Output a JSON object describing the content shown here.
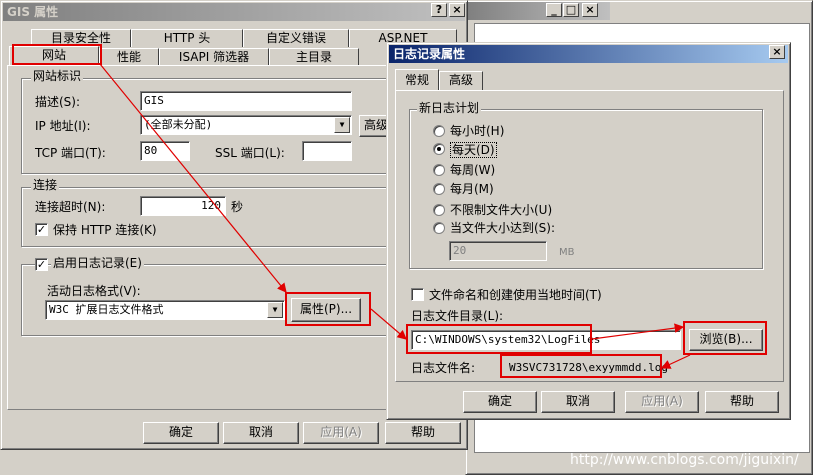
{
  "bg_window": {
    "title": "",
    "buttons": [
      "_",
      "□",
      "×"
    ]
  },
  "main_dialog": {
    "title": "GIS 属性",
    "help_btn": "?",
    "close_btn": "×",
    "tabs_row1": [
      "目录安全性",
      "HTTP 头",
      "自定义错误",
      "ASP.NET"
    ],
    "tabs_row2": [
      "网站",
      "性能",
      "ISAPI 筛选器",
      "主目录"
    ],
    "identity": {
      "group": "网站标识",
      "desc_label": "描述(S):",
      "desc_value": "GIS",
      "ip_label": "IP 地址(I):",
      "ip_value": "(全部未分配)",
      "advanced": "高级",
      "tcp_label": "TCP 端口(T):",
      "tcp_value": "80",
      "ssl_label": "SSL 端口(L):",
      "ssl_value": ""
    },
    "connection": {
      "group": "连接",
      "timeout_label": "连接超时(N):",
      "timeout_value": "120",
      "timeout_unit": "秒",
      "keepalive_label": "保持 HTTP 连接(K)",
      "keepalive_checked": true
    },
    "logging": {
      "enable_label": "启用日志记录(E)",
      "enable_checked": true,
      "format_label": "活动日志格式(V):",
      "format_value": "W3C 扩展日志文件格式",
      "properties": "属性(P)..."
    },
    "buttons": {
      "ok": "确定",
      "cancel": "取消",
      "apply": "应用(A)",
      "help": "帮助"
    }
  },
  "log_dialog": {
    "title": "日志记录属性",
    "close_btn": "×",
    "tabs": [
      "常规",
      "高级"
    ],
    "schedule_group": "新日志计划",
    "radios": [
      {
        "label": "每小时(H)",
        "checked": false
      },
      {
        "label": "每天(D)",
        "checked": true
      },
      {
        "label": "每周(W)",
        "checked": false
      },
      {
        "label": "每月(M)",
        "checked": false
      },
      {
        "label": "不限制文件大小(U)",
        "checked": false
      },
      {
        "label": "当文件大小达到(S):",
        "checked": false
      }
    ],
    "size_value": "20",
    "size_unit": "MB",
    "localtime_label": "文件命名和创建使用当地时间(T)",
    "localtime_checked": false,
    "dir_label": "日志文件目录(L):",
    "dir_value": "C:\\WINDOWS\\system32\\LogFiles",
    "browse": "浏览(B)...",
    "filename_label": "日志文件名:",
    "filename_value": "W3SVC731728\\exyymmdd.log",
    "buttons": {
      "ok": "确定",
      "cancel": "取消",
      "apply": "应用(A)",
      "help": "帮助"
    }
  },
  "watermark": "http://www.cnblogs.com/jiguixin/",
  "colors": {
    "annotation": "#e00000",
    "titlebar_active": "#0a246a"
  }
}
